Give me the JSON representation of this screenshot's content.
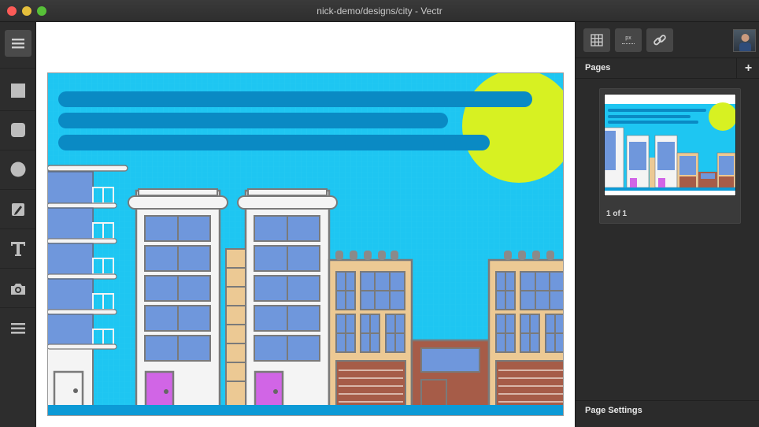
{
  "window": {
    "title": "nick-demo/designs/city - Vectr"
  },
  "toolbar": {
    "tools": [
      {
        "name": "menu-icon"
      },
      {
        "name": "rectangle-tool-icon"
      },
      {
        "name": "rounded-rectangle-tool-icon"
      },
      {
        "name": "ellipse-tool-icon"
      },
      {
        "name": "pen-tool-icon"
      },
      {
        "name": "text-tool-icon"
      },
      {
        "name": "image-tool-icon"
      },
      {
        "name": "more-icon"
      }
    ]
  },
  "right_panel": {
    "buttons": [
      {
        "name": "grid-icon"
      },
      {
        "name": "pixel-preview-icon",
        "label": "px"
      },
      {
        "name": "link-icon"
      }
    ],
    "pages_title": "Pages",
    "add_page_label": "+",
    "page_count": "1 of 1",
    "page_settings_title": "Page Settings"
  },
  "colors": {
    "sky": "#1ec6f2",
    "sun": "#d7f122",
    "cloud": "#0a8ac4",
    "window_blue": "#6f97dc",
    "door_pink": "#d165e6",
    "beige": "#ecc994",
    "brown": "#a65c48",
    "ground": "#0c9ad6"
  }
}
